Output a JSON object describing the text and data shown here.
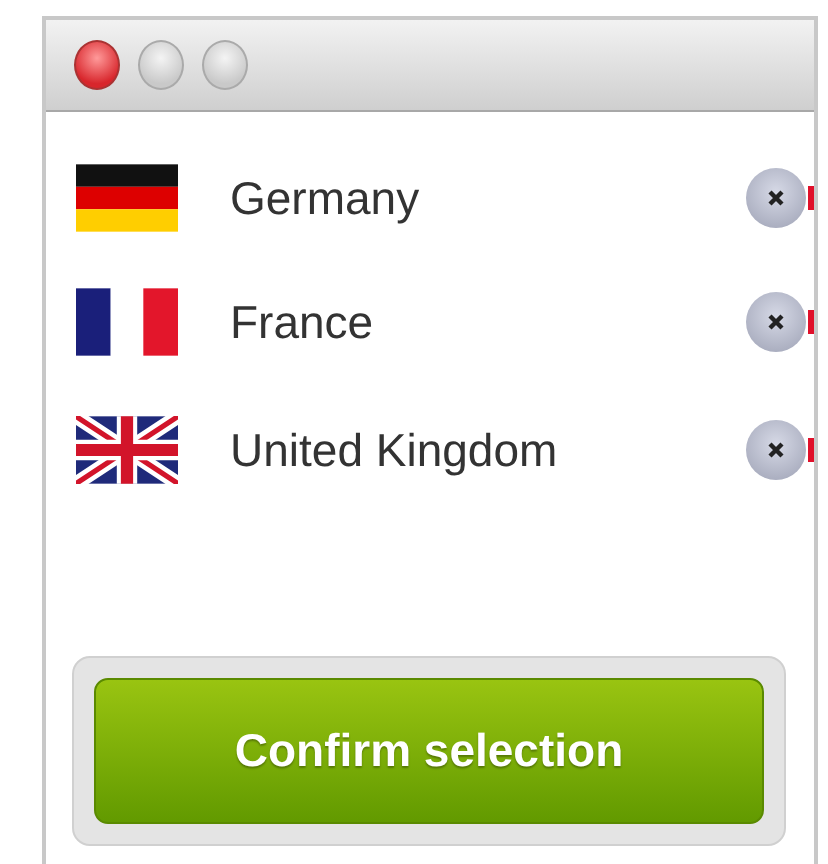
{
  "window": {
    "controls": [
      {
        "kind": "close"
      },
      {
        "kind": "minimize"
      },
      {
        "kind": "zoom"
      }
    ]
  },
  "countries": [
    {
      "name": "Germany",
      "kind": "de"
    },
    {
      "name": "France",
      "kind": "fr"
    },
    {
      "name": "United Kingdom",
      "kind": "gb"
    }
  ],
  "button": {
    "label": "Confirm selection"
  }
}
